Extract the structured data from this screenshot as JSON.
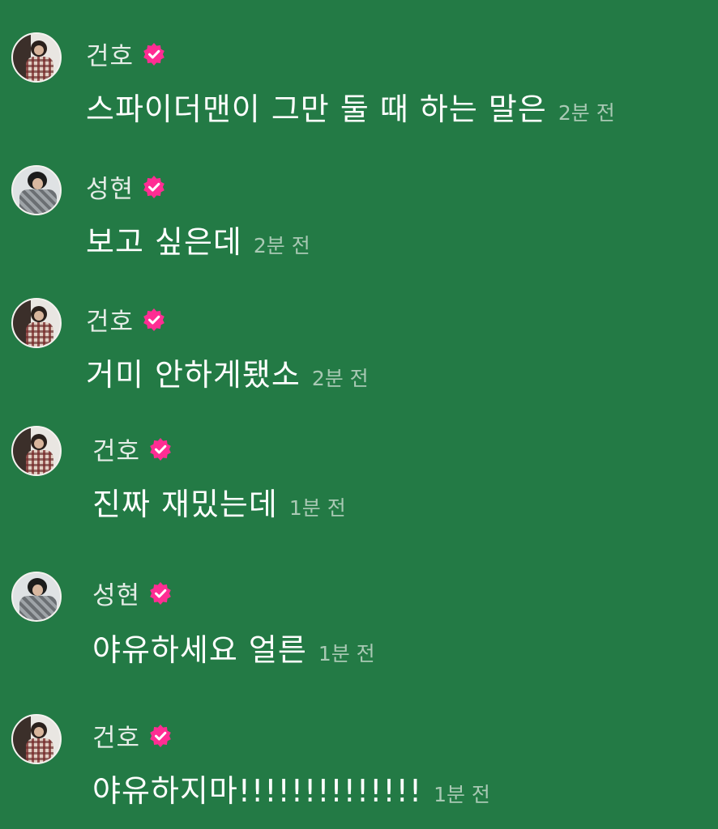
{
  "colors": {
    "background": "#237a45",
    "verified_badge": "#ff2d93",
    "timestamp": "#a9c9b4"
  },
  "messages": [
    {
      "user": "건호",
      "verified_icon": "verified-badge-icon",
      "text": "스파이더맨이 그만 둘 때 하는 말은",
      "time": "2분 전"
    },
    {
      "user": "성현",
      "verified_icon": "verified-badge-icon",
      "text": "보고 싶은데",
      "time": "2분 전"
    },
    {
      "user": "건호",
      "verified_icon": "verified-badge-icon",
      "text": "거미 안하게됐소",
      "time": "2분 전"
    },
    {
      "user": "건호",
      "verified_icon": "verified-badge-icon",
      "text": "진짜 재밌는데",
      "time": "1분 전"
    },
    {
      "user": "성현",
      "verified_icon": "verified-badge-icon",
      "text": "야유하세요 얼른",
      "time": "1분 전"
    },
    {
      "user": "건호",
      "verified_icon": "verified-badge-icon",
      "text": "야유하지마!!!!!!!!!!!!!!",
      "time": "1분 전"
    }
  ]
}
